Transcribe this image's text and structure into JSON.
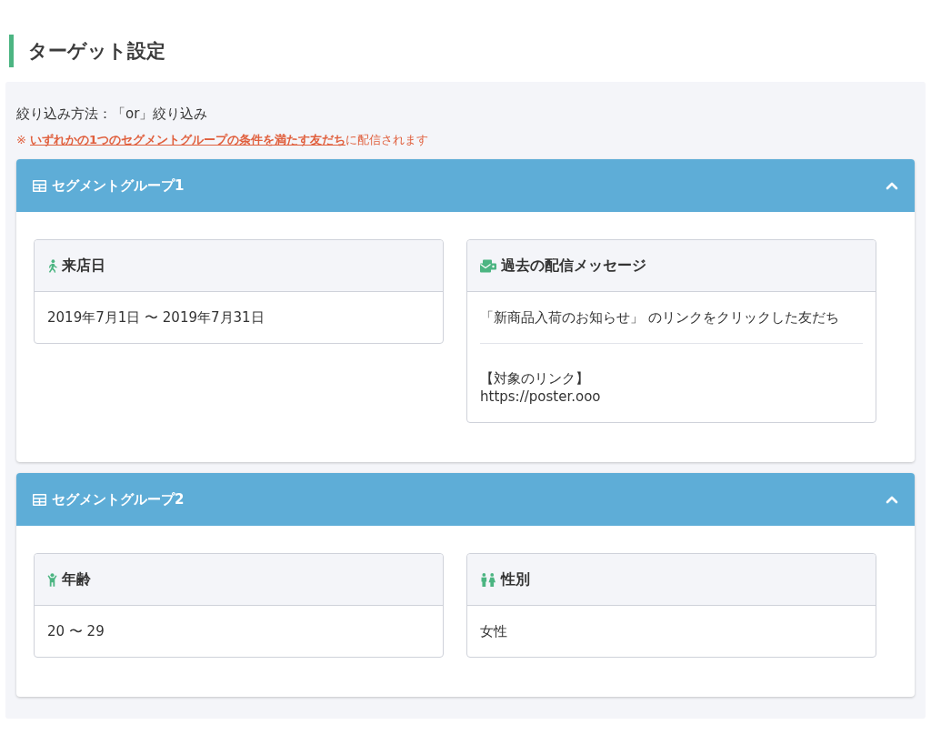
{
  "heading": "ターゲット設定",
  "filter_method": "絞り込み方法：「or」絞り込み",
  "note": {
    "prefix": "※ ",
    "link": "いずれかの1つのセグメントグループの条件を満たす友だち",
    "suffix": "に配信されます"
  },
  "groups": [
    {
      "title": "セグメントグループ1",
      "expanded": true,
      "conditions": [
        {
          "kind": "visit",
          "title": "来店日",
          "sections": [
            "2019年7月1日 〜 2019年7月31日"
          ]
        },
        {
          "kind": "message",
          "title": "過去の配信メッセージ",
          "sections": [
            "「新商品入荷のお知らせ」 のリンクをクリックした友だち",
            "【対象のリンク】\nhttps://poster.ooo"
          ]
        }
      ]
    },
    {
      "title": "セグメントグループ2",
      "expanded": true,
      "conditions": [
        {
          "kind": "age",
          "title": "年齢",
          "sections": [
            "20 〜 29"
          ]
        },
        {
          "kind": "gender",
          "title": "性別",
          "sections": [
            "女性"
          ]
        }
      ]
    }
  ]
}
